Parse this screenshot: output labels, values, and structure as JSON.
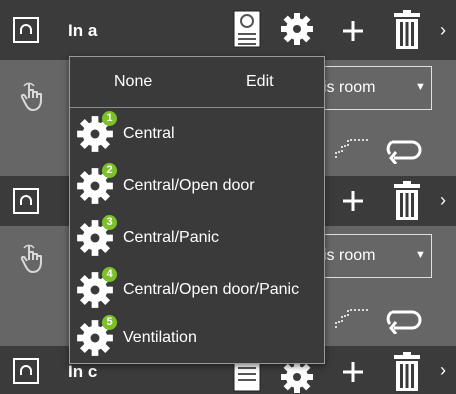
{
  "rows": [
    {
      "title": "In a",
      "room_select": "is room"
    },
    {
      "title": "I",
      "room_select": "is room"
    },
    {
      "title": "In c"
    }
  ],
  "menu": {
    "none_label": "None",
    "edit_label": "Edit",
    "items": [
      {
        "badge": "1",
        "label": "Central"
      },
      {
        "badge": "2",
        "label": "Central/Open door"
      },
      {
        "badge": "3",
        "label": "Central/Panic"
      },
      {
        "badge": "4",
        "label": "Central/Open door/Panic"
      },
      {
        "badge": "5",
        "label": "Ventilation"
      }
    ]
  },
  "colors": {
    "header_bg": "#3b3b3b",
    "body_bg": "#666666",
    "menu_bg": "#3a3a3a",
    "badge_green": "#7cc02a"
  },
  "icons": [
    "corner-icon",
    "document-icon",
    "gear-icon",
    "plus-icon",
    "trash-icon",
    "chevron-right-icon",
    "hand-touch-icon",
    "step-icon",
    "loop-icon"
  ]
}
